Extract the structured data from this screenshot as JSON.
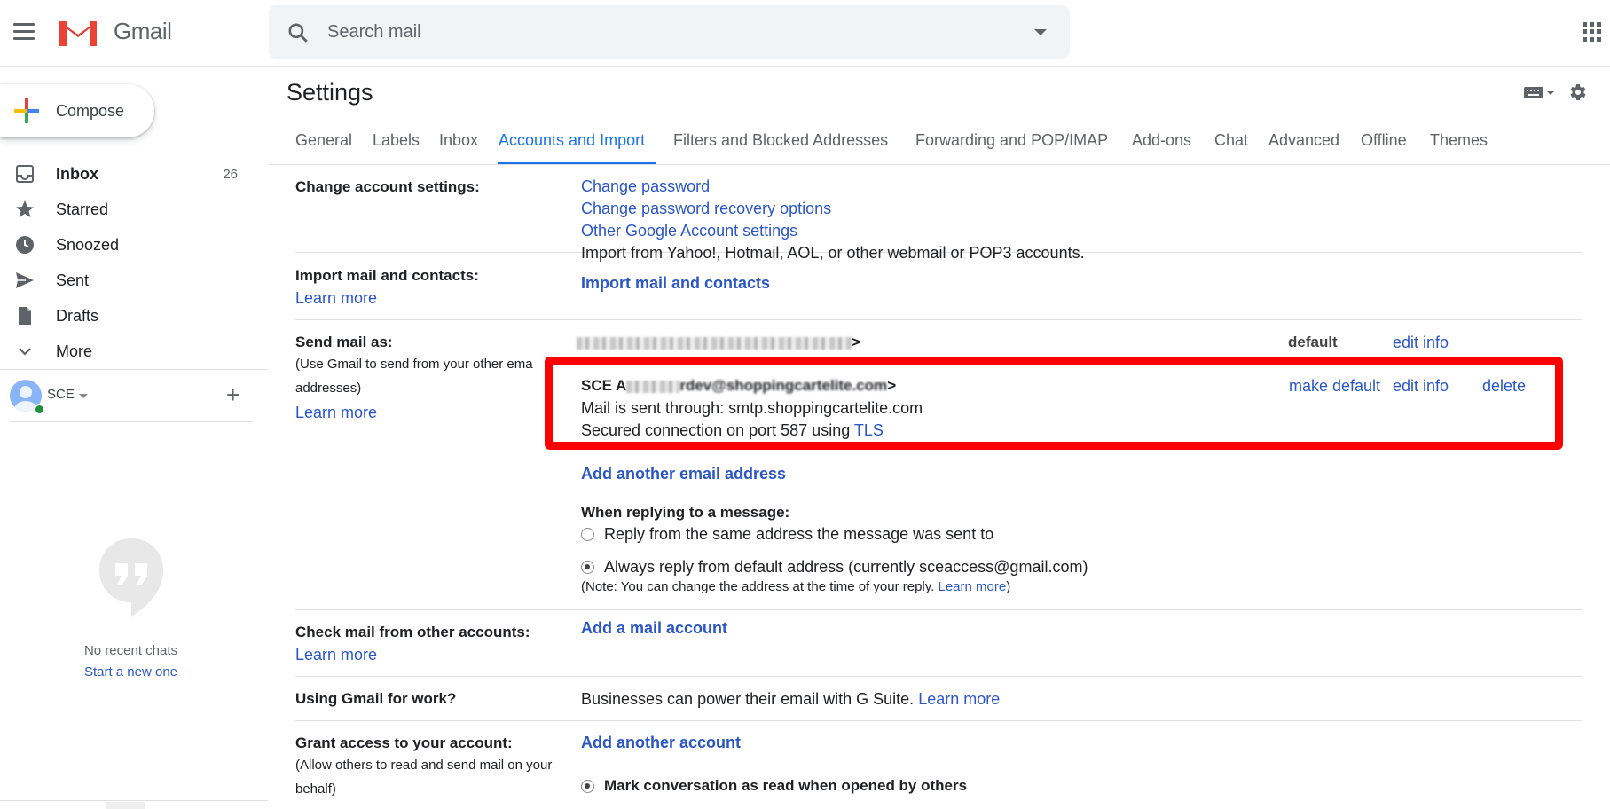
{
  "header": {
    "app_name": "Gmail",
    "search_placeholder": "Search mail"
  },
  "sidebar": {
    "compose_label": "Compose",
    "items": [
      {
        "label": "Inbox",
        "count": "26",
        "icon": "inbox-icon"
      },
      {
        "label": "Starred",
        "icon": "star-icon"
      },
      {
        "label": "Snoozed",
        "icon": "clock-icon"
      },
      {
        "label": "Sent",
        "icon": "send-icon"
      },
      {
        "label": "Drafts",
        "icon": "draft-icon"
      },
      {
        "label": "More",
        "icon": "chevron-down-icon"
      }
    ],
    "user": "SCE",
    "no_chats": "No recent chats",
    "start_chat": "Start a new one"
  },
  "settings": {
    "title": "Settings",
    "tabs": [
      "General",
      "Labels",
      "Inbox",
      "Accounts and Import",
      "Filters and Blocked Addresses",
      "Forwarding and POP/IMAP",
      "Add-ons",
      "Chat",
      "Advanced",
      "Offline",
      "Themes"
    ],
    "active_tab": "Accounts and Import",
    "change_account": {
      "label": "Change account settings:",
      "links": [
        "Change password",
        "Change password recovery options",
        "Other Google Account settings"
      ]
    },
    "import": {
      "label": "Import mail and contacts:",
      "learn_more": "Learn more",
      "description": "Import from Yahoo!, Hotmail, AOL, or other webmail or POP3 accounts.",
      "action": "Import mail and contacts"
    },
    "send_as": {
      "label": "Send mail as:",
      "sub": "(Use Gmail to send from your other ema",
      "sub2": "addresses)",
      "learn_more": "Learn more",
      "row1_suffix": ">",
      "row1_default": "default",
      "row1_edit": "edit info",
      "row2_prefix": "SCE A",
      "row2_mid": "rdev@shoppingcartelite.com",
      "row2_suffix": ">",
      "row2_make_default": "make default",
      "row2_edit": "edit info",
      "row2_delete": "delete",
      "row2_smtp": "Mail is sent through: smtp.shoppingcartelite.com",
      "row2_secure": "Secured connection on port 587 using",
      "row2_tls": "TLS",
      "add_another": "Add another email address",
      "replying_label": "When replying to a message:",
      "reply_opt1": "Reply from the same address the message was sent to",
      "reply_opt2": "Always reply from default address (currently sceaccess@gmail.com)",
      "note": "(Note: You can change the address at the time of your reply.",
      "note_link": "Learn more",
      "note_end": ")"
    },
    "check_mail": {
      "label": "Check mail from other accounts:",
      "learn_more": "Learn more",
      "action": "Add a mail account"
    },
    "work": {
      "label": "Using Gmail for work?",
      "text": "Businesses can power their email with G Suite.",
      "link": "Learn more"
    },
    "grant": {
      "label": "Grant access to your account:",
      "sub": "(Allow others to read and send mail on your",
      "sub2": "behalf)",
      "action": "Add another account",
      "option": "Mark conversation as read when opened by others"
    }
  },
  "colors": {
    "accent": "#1a73e8",
    "link": "#2a56c6",
    "highlight": "#ff0000"
  }
}
